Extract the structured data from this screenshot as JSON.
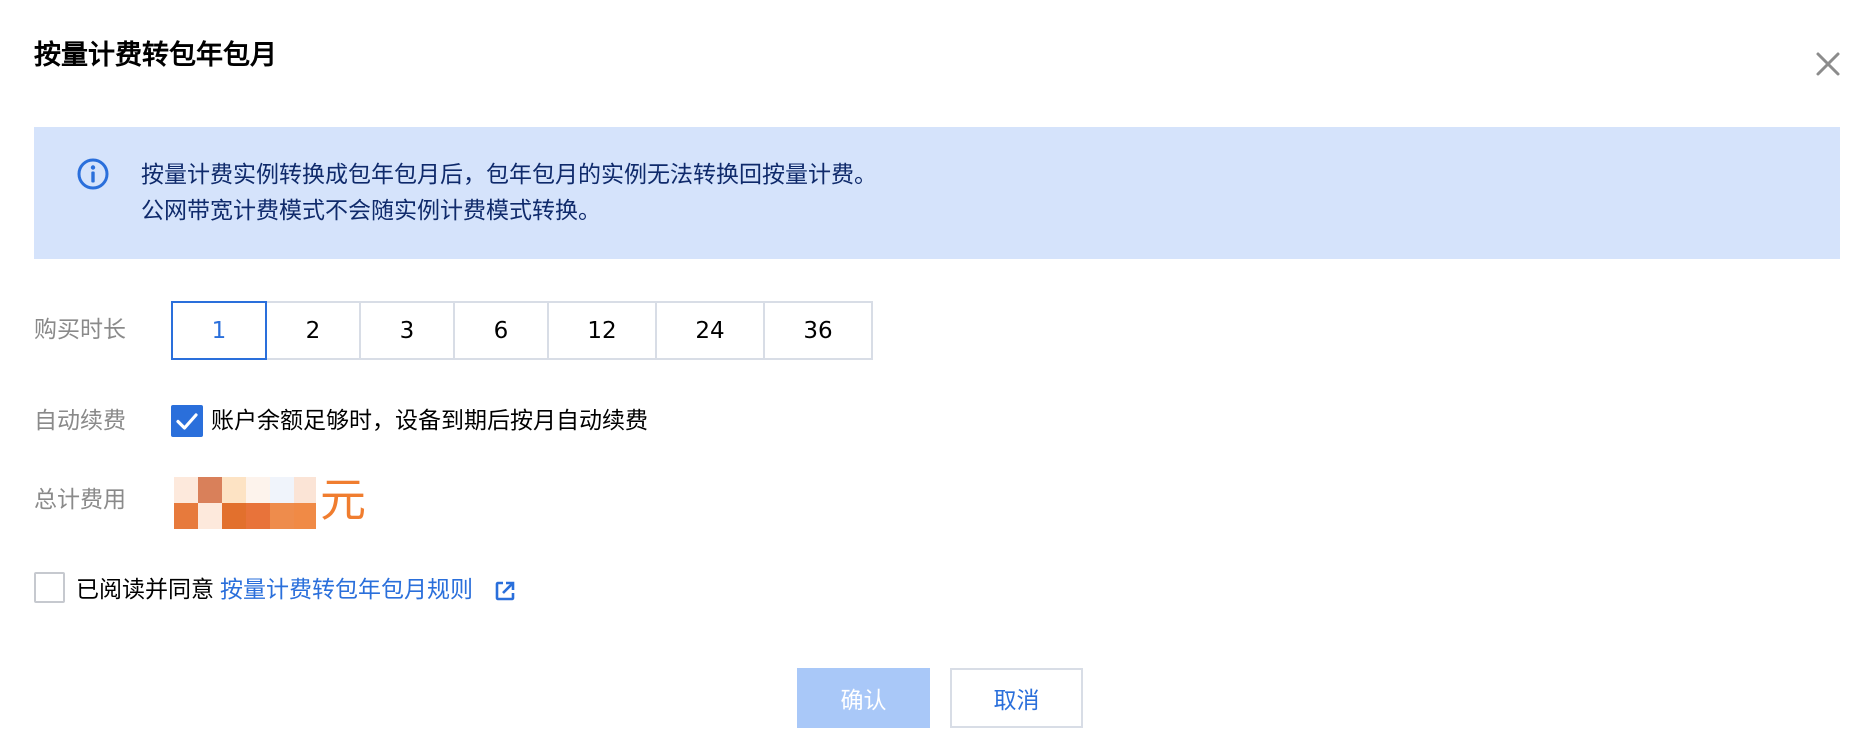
{
  "dialog": {
    "title": "按量计费转包年包月"
  },
  "notice": {
    "line1": "按量计费实例转换成包年包月后，包年包月的实例无法转换回按量计费。",
    "line2": "公网带宽计费模式不会随实例计费模式转换。"
  },
  "form": {
    "duration_label": "购买时长",
    "duration_options": [
      "1",
      "2",
      "3",
      "6",
      "12",
      "24",
      "36"
    ],
    "duration_selected": "1",
    "auto_renew_label": "自动续费",
    "auto_renew_checked": true,
    "auto_renew_text": "账户余额足够时，设备到期后按月自动续费",
    "total_label": "总计费用",
    "price_unit": "元"
  },
  "agreement": {
    "checked": false,
    "text": "已阅读并同意",
    "link_text": "按量计费转包年包月规则"
  },
  "buttons": {
    "confirm": "确认",
    "cancel": "取消"
  },
  "colors": {
    "accent": "#2a6fdb",
    "notice_bg": "#d5e3fb",
    "price": "#f07d2f",
    "confirm_disabled_bg": "#a9c8f8"
  },
  "icons": {
    "close": "close-icon",
    "info": "info-icon",
    "check": "check-icon",
    "external_link": "external-link-icon"
  }
}
